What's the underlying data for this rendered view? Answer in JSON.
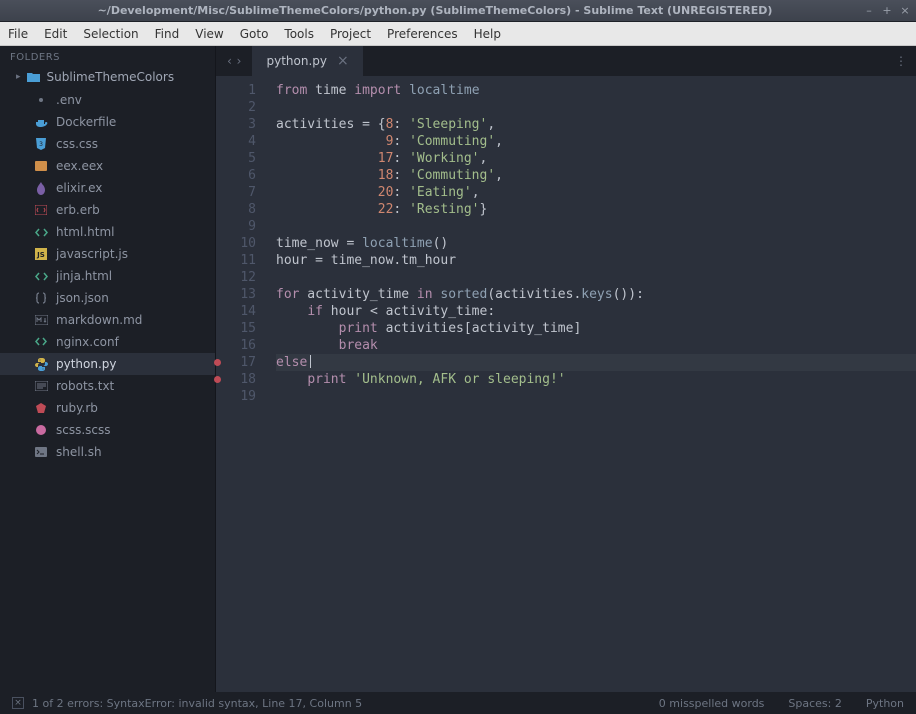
{
  "window": {
    "title": "~/Development/Misc/SublimeThemeColors/python.py (SublimeThemeColors) - Sublime Text (UNREGISTERED)"
  },
  "menu": [
    "File",
    "Edit",
    "Selection",
    "Find",
    "View",
    "Goto",
    "Tools",
    "Project",
    "Preferences",
    "Help"
  ],
  "sidebar": {
    "header": "FOLDERS",
    "root": "SublimeThemeColors",
    "files": [
      {
        "name": ".env",
        "icon": "dot",
        "color": "#6f7684"
      },
      {
        "name": "Dockerfile",
        "icon": "docker",
        "color": "#4a9ed6"
      },
      {
        "name": "css.css",
        "icon": "css",
        "color": "#4a9ed6"
      },
      {
        "name": "eex.eex",
        "icon": "eex",
        "color": "#d08f4a"
      },
      {
        "name": "elixir.ex",
        "icon": "elixir",
        "color": "#7a5fa5"
      },
      {
        "name": "erb.erb",
        "icon": "erb",
        "color": "#bf4b56"
      },
      {
        "name": "html.html",
        "icon": "html",
        "color": "#4aa889"
      },
      {
        "name": "javascript.js",
        "icon": "js",
        "color": "#d0b34a"
      },
      {
        "name": "jinja.html",
        "icon": "jinja",
        "color": "#4aa889"
      },
      {
        "name": "json.json",
        "icon": "json",
        "color": "#6f7684"
      },
      {
        "name": "markdown.md",
        "icon": "md",
        "color": "#6f7684"
      },
      {
        "name": "nginx.conf",
        "icon": "nginx",
        "color": "#4aa889"
      },
      {
        "name": "python.py",
        "icon": "py",
        "color": "#d0b34a",
        "active": true
      },
      {
        "name": "robots.txt",
        "icon": "txt",
        "color": "#6f7684"
      },
      {
        "name": "ruby.rb",
        "icon": "ruby",
        "color": "#bf4b56"
      },
      {
        "name": "scss.scss",
        "icon": "scss",
        "color": "#c96aa0"
      },
      {
        "name": "shell.sh",
        "icon": "sh",
        "color": "#6f7684"
      }
    ]
  },
  "tab": {
    "label": "python.py"
  },
  "code": {
    "lines": [
      {
        "n": 1,
        "tokens": [
          [
            "from",
            "kw"
          ],
          [
            " ",
            "op"
          ],
          [
            "time",
            "id"
          ],
          [
            " ",
            "op"
          ],
          [
            "import",
            "kw"
          ],
          [
            " ",
            "op"
          ],
          [
            "localtime",
            "fn"
          ]
        ]
      },
      {
        "n": 2,
        "tokens": []
      },
      {
        "n": 3,
        "tokens": [
          [
            "activities ",
            "id"
          ],
          [
            "= ",
            "eq"
          ],
          [
            "{",
            "punct"
          ],
          [
            "8",
            "num"
          ],
          [
            ": ",
            "punct"
          ],
          [
            "'Sleeping'",
            "str"
          ],
          [
            ",",
            "punct"
          ]
        ]
      },
      {
        "n": 4,
        "tokens": [
          [
            "              ",
            "op"
          ],
          [
            "9",
            "num"
          ],
          [
            ": ",
            "punct"
          ],
          [
            "'Commuting'",
            "str"
          ],
          [
            ",",
            "punct"
          ]
        ]
      },
      {
        "n": 5,
        "tokens": [
          [
            "             ",
            "op"
          ],
          [
            "17",
            "num"
          ],
          [
            ": ",
            "punct"
          ],
          [
            "'Working'",
            "str"
          ],
          [
            ",",
            "punct"
          ]
        ]
      },
      {
        "n": 6,
        "tokens": [
          [
            "             ",
            "op"
          ],
          [
            "18",
            "num"
          ],
          [
            ": ",
            "punct"
          ],
          [
            "'Commuting'",
            "str"
          ],
          [
            ",",
            "punct"
          ]
        ]
      },
      {
        "n": 7,
        "tokens": [
          [
            "             ",
            "op"
          ],
          [
            "20",
            "num"
          ],
          [
            ": ",
            "punct"
          ],
          [
            "'Eating'",
            "str"
          ],
          [
            ",",
            "punct"
          ]
        ]
      },
      {
        "n": 8,
        "tokens": [
          [
            "             ",
            "op"
          ],
          [
            "22",
            "num"
          ],
          [
            ": ",
            "punct"
          ],
          [
            "'Resting'",
            "str"
          ],
          [
            "}",
            "punct"
          ]
        ]
      },
      {
        "n": 9,
        "tokens": []
      },
      {
        "n": 10,
        "tokens": [
          [
            "time_now ",
            "id"
          ],
          [
            "= ",
            "eq"
          ],
          [
            "localtime",
            "builtin"
          ],
          [
            "()",
            "punct"
          ]
        ]
      },
      {
        "n": 11,
        "tokens": [
          [
            "hour ",
            "id"
          ],
          [
            "= ",
            "eq"
          ],
          [
            "time_now",
            "id"
          ],
          [
            ".",
            "punct"
          ],
          [
            "tm_hour",
            "id"
          ]
        ]
      },
      {
        "n": 12,
        "tokens": []
      },
      {
        "n": 13,
        "tokens": [
          [
            "for",
            "kw"
          ],
          [
            " activity_time ",
            "id"
          ],
          [
            "in",
            "kw"
          ],
          [
            " ",
            "op"
          ],
          [
            "sorted",
            "builtin"
          ],
          [
            "(",
            "punct"
          ],
          [
            "activities",
            "id"
          ],
          [
            ".",
            "punct"
          ],
          [
            "keys",
            "builtin"
          ],
          [
            "()):",
            "punct"
          ]
        ]
      },
      {
        "n": 14,
        "tokens": [
          [
            "    ",
            "op"
          ],
          [
            "if",
            "kw"
          ],
          [
            " hour ",
            "id"
          ],
          [
            "<",
            "op"
          ],
          [
            " activity_time",
            "id"
          ],
          [
            ":",
            "punct"
          ]
        ]
      },
      {
        "n": 15,
        "tokens": [
          [
            "        ",
            "op"
          ],
          [
            "print",
            "kw"
          ],
          [
            " activities",
            "id"
          ],
          [
            "[",
            "punct"
          ],
          [
            "activity_time",
            "id"
          ],
          [
            "]",
            "punct"
          ]
        ]
      },
      {
        "n": 16,
        "tokens": [
          [
            "        ",
            "op"
          ],
          [
            "break",
            "kw"
          ]
        ]
      },
      {
        "n": 17,
        "tokens": [
          [
            "else",
            "kw"
          ]
        ],
        "dot": true,
        "hl": true,
        "cursor": true
      },
      {
        "n": 18,
        "tokens": [
          [
            "    ",
            "op"
          ],
          [
            "print",
            "kw"
          ],
          [
            " ",
            "op"
          ],
          [
            "'Unknown, AFK or sleeping!'",
            "str"
          ]
        ],
        "dot": true
      },
      {
        "n": 19,
        "tokens": []
      }
    ]
  },
  "status": {
    "error": "1 of 2 errors: SyntaxError: invalid syntax, Line 17, Column 5",
    "misspelled": "0 misspelled words",
    "spaces": "Spaces: 2",
    "lang": "Python"
  }
}
